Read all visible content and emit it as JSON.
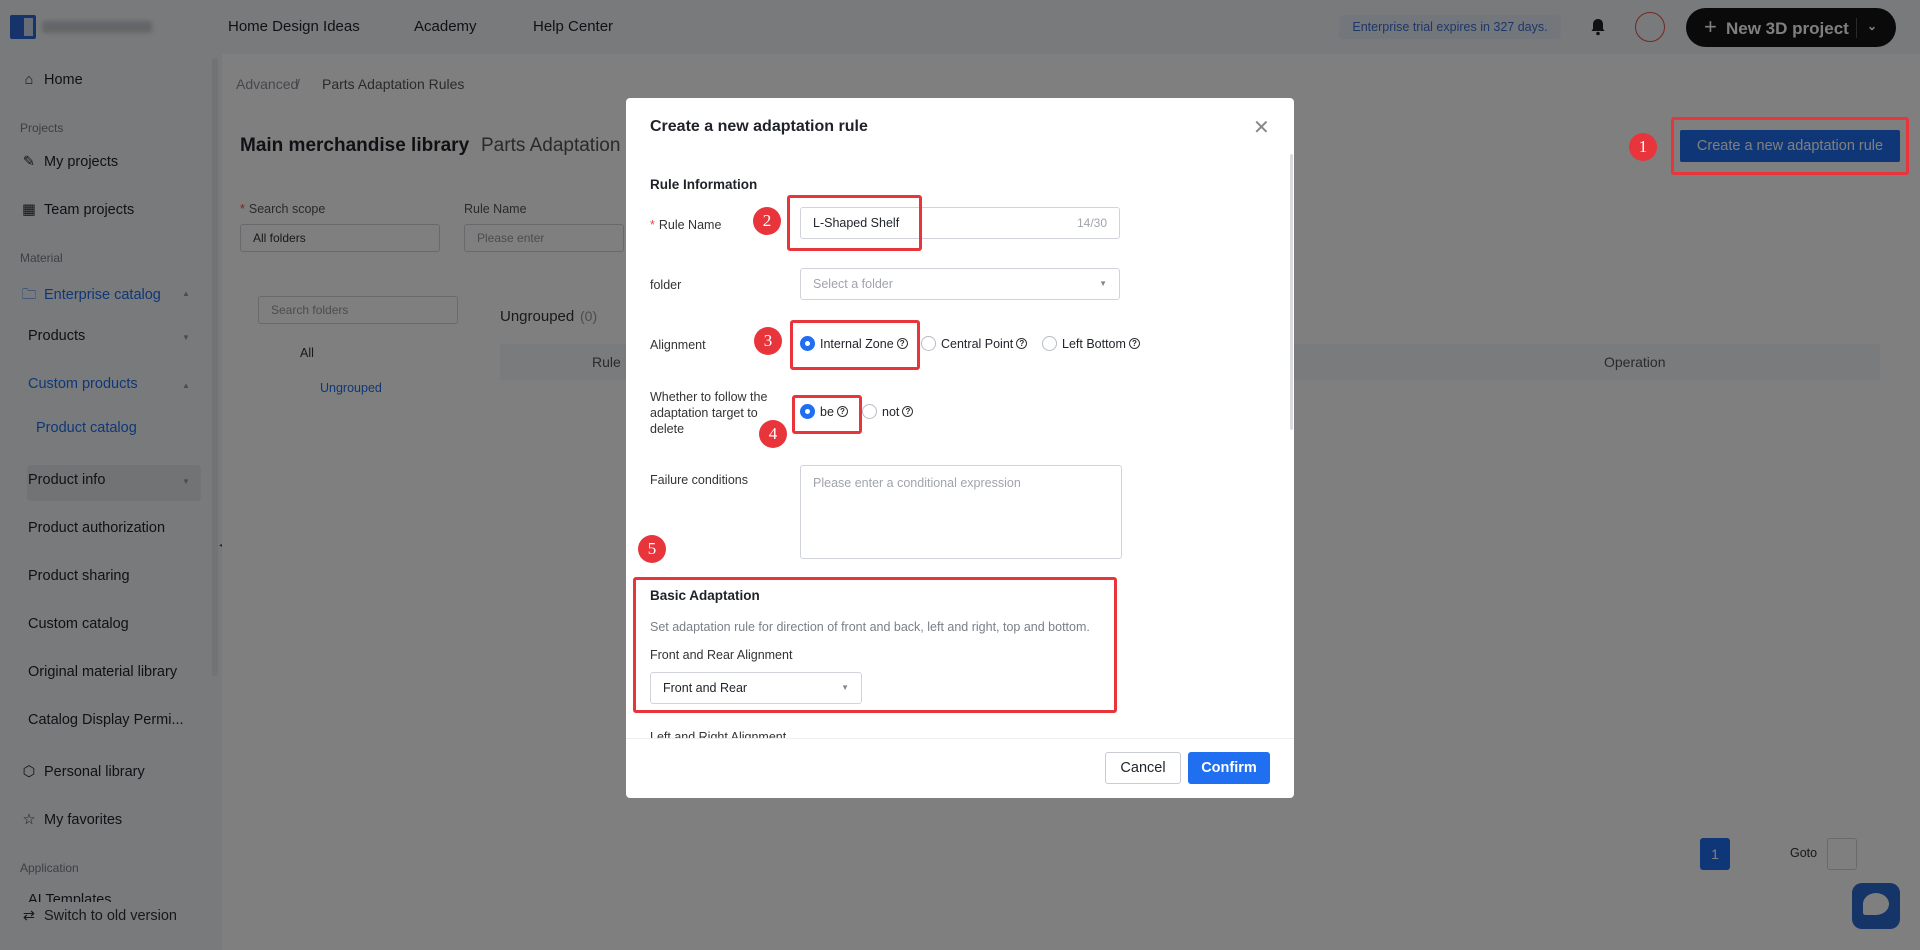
{
  "topbar": {
    "nav": [
      "Home Design Ideas",
      "Academy",
      "Help Center"
    ],
    "trial": "Enterprise trial expires in 327 days.",
    "new_project": "New 3D project"
  },
  "sidebar": {
    "home": "Home",
    "sec_projects": "Projects",
    "my_projects": "My projects",
    "team_projects": "Team projects",
    "sec_material": "Material",
    "enterprise_catalog": "Enterprise catalog",
    "products": "Products",
    "custom_products": "Custom products",
    "product_catalog": "Product catalog",
    "product_info": "Product info",
    "product_authorization": "Product authorization",
    "product_sharing": "Product sharing",
    "custom_catalog": "Custom catalog",
    "original_material": "Original material library",
    "catalog_display": "Catalog Display Permi...",
    "personal_library": "Personal library",
    "my_favorites": "My favorites",
    "sec_application": "Application",
    "ai_templates": "AI Templates",
    "switch_old": "Switch to old version"
  },
  "main": {
    "crumb_1": "Advanced",
    "crumb_2": "Parts Adaptation Rules",
    "tab_main": "Main merchandise library",
    "tab_parts": "Parts Adaptation",
    "create_button": "Create a new adaptation rule",
    "search_scope_label": "Search scope",
    "search_scope_value": "All folders",
    "rule_name_label": "Rule Name",
    "rule_name_placeholder": "Please enter",
    "search_folders_placeholder": "Search folders",
    "tree_all": "All",
    "tree_ungrouped": "Ungrouped",
    "group_title": "Ungrouped",
    "group_count": "(0)",
    "col_rule": "Rule",
    "col_operation": "Operation",
    "page_current": "1",
    "goto_label": "Goto"
  },
  "modal": {
    "title": "Create a new adaptation rule",
    "section_rule_info": "Rule Information",
    "rule_name_label": "Rule Name",
    "rule_name_value": "L-Shaped Shelf",
    "rule_name_count": "14/30",
    "folder_label": "folder",
    "folder_placeholder": "Select a folder",
    "alignment_label": "Alignment",
    "alignment_options": [
      "Internal Zone",
      "Central Point",
      "Left Bottom"
    ],
    "alignment_selected": "Internal Zone",
    "follow_delete_label": "Whether to follow the adaptation target to delete",
    "follow_options": [
      "be",
      "not"
    ],
    "follow_selected": "be",
    "failure_label": "Failure conditions",
    "failure_placeholder": "Please enter a conditional expression",
    "basic_title": "Basic Adaptation",
    "basic_desc": "Set adaptation rule for direction of front and back, left and right, top and bottom.",
    "front_rear_label": "Front and Rear Alignment",
    "front_rear_value": "Front and Rear",
    "left_right_label": "Left and Right Alignment",
    "cancel": "Cancel",
    "confirm": "Confirm"
  },
  "annotations": [
    "1",
    "2",
    "3",
    "4",
    "5"
  ],
  "colors": {
    "accent": "#1f6ff0",
    "annotation": "#e8353b"
  }
}
